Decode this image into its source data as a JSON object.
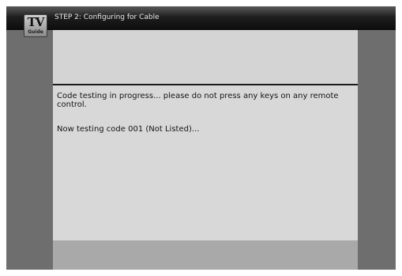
{
  "app": {
    "logo_main": "TV",
    "logo_sub": "Guide"
  },
  "header": {
    "title": "STEP 2: Configuring for Cable"
  },
  "content": {
    "message": "Code testing in progress... please do not press any keys on any remote control.",
    "status": "Now testing code 001 (Not Listed)..."
  },
  "colors": {
    "title_bar": "#0c0c0c",
    "screen_background": "#6e6e6e",
    "panel_background": "#d6d6d6",
    "footer_background": "#a9a9a9",
    "divider": "#1a1a1a"
  }
}
